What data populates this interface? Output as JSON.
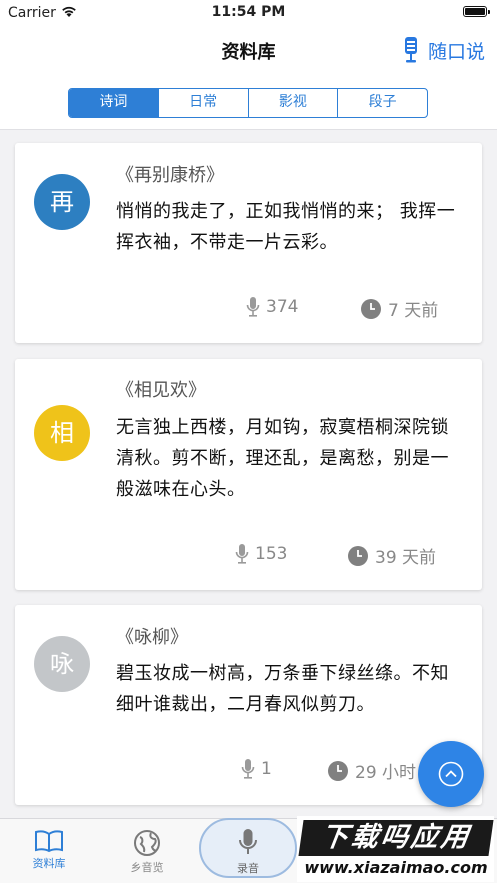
{
  "status_bar": {
    "carrier": "Carrier",
    "time": "11:54 PM"
  },
  "nav": {
    "title": "资料库",
    "right_action": "随口说",
    "right_icon": "microphone-icon"
  },
  "segments": [
    {
      "label": "诗词",
      "active": true
    },
    {
      "label": "日常",
      "active": false
    },
    {
      "label": "影视",
      "active": false
    },
    {
      "label": "段子",
      "active": false
    }
  ],
  "cards": [
    {
      "avatar_char": "再",
      "avatar_color": "#2d7fc1",
      "title": "《再别康桥》",
      "body": "悄悄的我走了，正如我悄悄的来； 我挥一挥衣袖，不带走一片云彩。",
      "listens": "374",
      "time": "7 天前"
    },
    {
      "avatar_char": "相",
      "avatar_color": "#efc31a",
      "title": "《相见欢》",
      "body": "无言独上西楼，月如钩，寂寞梧桐深院锁清秋。剪不断，理还乱，是离愁，别是一般滋味在心头。",
      "listens": "153",
      "time": "39 天前"
    },
    {
      "avatar_char": "咏",
      "avatar_color": "#c3c6c9",
      "title": "《咏柳》",
      "body": "碧玉妆成一树高，万条垂下绿丝绦。不知细叶谁裁出，二月春风似剪刀。",
      "listens": "1",
      "time": "29 小时"
    }
  ],
  "fab": {
    "icon": "chevron-up-icon"
  },
  "tabs": [
    {
      "label": "资料库",
      "icon": "book-icon",
      "active": true
    },
    {
      "label": "乡音览",
      "icon": "globe-icon",
      "active": false
    },
    {
      "label": "录音",
      "icon": "microphone-icon",
      "active": false
    }
  ],
  "watermark": {
    "main": "下载吗应用",
    "url": "www.xiazaimao.com"
  },
  "colors": {
    "accent": "#2e7fd6",
    "fab": "#2e84e6"
  }
}
